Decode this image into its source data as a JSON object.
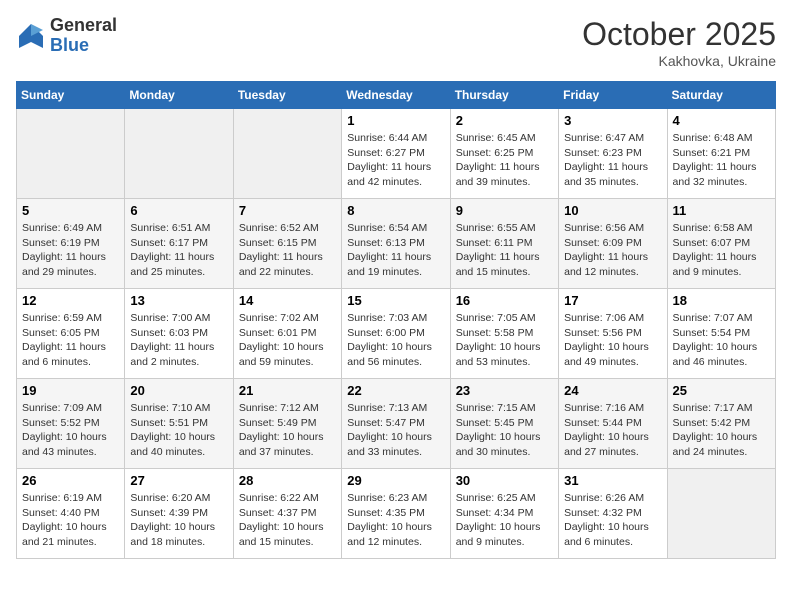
{
  "header": {
    "logo": {
      "general": "General",
      "blue": "Blue"
    },
    "title": "October 2025",
    "location": "Kakhovka, Ukraine"
  },
  "weekdays": [
    "Sunday",
    "Monday",
    "Tuesday",
    "Wednesday",
    "Thursday",
    "Friday",
    "Saturday"
  ],
  "weeks": [
    [
      {
        "day": null,
        "sunrise": null,
        "sunset": null,
        "daylight": null
      },
      {
        "day": null,
        "sunrise": null,
        "sunset": null,
        "daylight": null
      },
      {
        "day": null,
        "sunrise": null,
        "sunset": null,
        "daylight": null
      },
      {
        "day": "1",
        "sunrise": "Sunrise: 6:44 AM",
        "sunset": "Sunset: 6:27 PM",
        "daylight": "Daylight: 11 hours and 42 minutes."
      },
      {
        "day": "2",
        "sunrise": "Sunrise: 6:45 AM",
        "sunset": "Sunset: 6:25 PM",
        "daylight": "Daylight: 11 hours and 39 minutes."
      },
      {
        "day": "3",
        "sunrise": "Sunrise: 6:47 AM",
        "sunset": "Sunset: 6:23 PM",
        "daylight": "Daylight: 11 hours and 35 minutes."
      },
      {
        "day": "4",
        "sunrise": "Sunrise: 6:48 AM",
        "sunset": "Sunset: 6:21 PM",
        "daylight": "Daylight: 11 hours and 32 minutes."
      }
    ],
    [
      {
        "day": "5",
        "sunrise": "Sunrise: 6:49 AM",
        "sunset": "Sunset: 6:19 PM",
        "daylight": "Daylight: 11 hours and 29 minutes."
      },
      {
        "day": "6",
        "sunrise": "Sunrise: 6:51 AM",
        "sunset": "Sunset: 6:17 PM",
        "daylight": "Daylight: 11 hours and 25 minutes."
      },
      {
        "day": "7",
        "sunrise": "Sunrise: 6:52 AM",
        "sunset": "Sunset: 6:15 PM",
        "daylight": "Daylight: 11 hours and 22 minutes."
      },
      {
        "day": "8",
        "sunrise": "Sunrise: 6:54 AM",
        "sunset": "Sunset: 6:13 PM",
        "daylight": "Daylight: 11 hours and 19 minutes."
      },
      {
        "day": "9",
        "sunrise": "Sunrise: 6:55 AM",
        "sunset": "Sunset: 6:11 PM",
        "daylight": "Daylight: 11 hours and 15 minutes."
      },
      {
        "day": "10",
        "sunrise": "Sunrise: 6:56 AM",
        "sunset": "Sunset: 6:09 PM",
        "daylight": "Daylight: 11 hours and 12 minutes."
      },
      {
        "day": "11",
        "sunrise": "Sunrise: 6:58 AM",
        "sunset": "Sunset: 6:07 PM",
        "daylight": "Daylight: 11 hours and 9 minutes."
      }
    ],
    [
      {
        "day": "12",
        "sunrise": "Sunrise: 6:59 AM",
        "sunset": "Sunset: 6:05 PM",
        "daylight": "Daylight: 11 hours and 6 minutes."
      },
      {
        "day": "13",
        "sunrise": "Sunrise: 7:00 AM",
        "sunset": "Sunset: 6:03 PM",
        "daylight": "Daylight: 11 hours and 2 minutes."
      },
      {
        "day": "14",
        "sunrise": "Sunrise: 7:02 AM",
        "sunset": "Sunset: 6:01 PM",
        "daylight": "Daylight: 10 hours and 59 minutes."
      },
      {
        "day": "15",
        "sunrise": "Sunrise: 7:03 AM",
        "sunset": "Sunset: 6:00 PM",
        "daylight": "Daylight: 10 hours and 56 minutes."
      },
      {
        "day": "16",
        "sunrise": "Sunrise: 7:05 AM",
        "sunset": "Sunset: 5:58 PM",
        "daylight": "Daylight: 10 hours and 53 minutes."
      },
      {
        "day": "17",
        "sunrise": "Sunrise: 7:06 AM",
        "sunset": "Sunset: 5:56 PM",
        "daylight": "Daylight: 10 hours and 49 minutes."
      },
      {
        "day": "18",
        "sunrise": "Sunrise: 7:07 AM",
        "sunset": "Sunset: 5:54 PM",
        "daylight": "Daylight: 10 hours and 46 minutes."
      }
    ],
    [
      {
        "day": "19",
        "sunrise": "Sunrise: 7:09 AM",
        "sunset": "Sunset: 5:52 PM",
        "daylight": "Daylight: 10 hours and 43 minutes."
      },
      {
        "day": "20",
        "sunrise": "Sunrise: 7:10 AM",
        "sunset": "Sunset: 5:51 PM",
        "daylight": "Daylight: 10 hours and 40 minutes."
      },
      {
        "day": "21",
        "sunrise": "Sunrise: 7:12 AM",
        "sunset": "Sunset: 5:49 PM",
        "daylight": "Daylight: 10 hours and 37 minutes."
      },
      {
        "day": "22",
        "sunrise": "Sunrise: 7:13 AM",
        "sunset": "Sunset: 5:47 PM",
        "daylight": "Daylight: 10 hours and 33 minutes."
      },
      {
        "day": "23",
        "sunrise": "Sunrise: 7:15 AM",
        "sunset": "Sunset: 5:45 PM",
        "daylight": "Daylight: 10 hours and 30 minutes."
      },
      {
        "day": "24",
        "sunrise": "Sunrise: 7:16 AM",
        "sunset": "Sunset: 5:44 PM",
        "daylight": "Daylight: 10 hours and 27 minutes."
      },
      {
        "day": "25",
        "sunrise": "Sunrise: 7:17 AM",
        "sunset": "Sunset: 5:42 PM",
        "daylight": "Daylight: 10 hours and 24 minutes."
      }
    ],
    [
      {
        "day": "26",
        "sunrise": "Sunrise: 6:19 AM",
        "sunset": "Sunset: 4:40 PM",
        "daylight": "Daylight: 10 hours and 21 minutes."
      },
      {
        "day": "27",
        "sunrise": "Sunrise: 6:20 AM",
        "sunset": "Sunset: 4:39 PM",
        "daylight": "Daylight: 10 hours and 18 minutes."
      },
      {
        "day": "28",
        "sunrise": "Sunrise: 6:22 AM",
        "sunset": "Sunset: 4:37 PM",
        "daylight": "Daylight: 10 hours and 15 minutes."
      },
      {
        "day": "29",
        "sunrise": "Sunrise: 6:23 AM",
        "sunset": "Sunset: 4:35 PM",
        "daylight": "Daylight: 10 hours and 12 minutes."
      },
      {
        "day": "30",
        "sunrise": "Sunrise: 6:25 AM",
        "sunset": "Sunset: 4:34 PM",
        "daylight": "Daylight: 10 hours and 9 minutes."
      },
      {
        "day": "31",
        "sunrise": "Sunrise: 6:26 AM",
        "sunset": "Sunset: 4:32 PM",
        "daylight": "Daylight: 10 hours and 6 minutes."
      },
      {
        "day": null,
        "sunrise": null,
        "sunset": null,
        "daylight": null
      }
    ]
  ]
}
